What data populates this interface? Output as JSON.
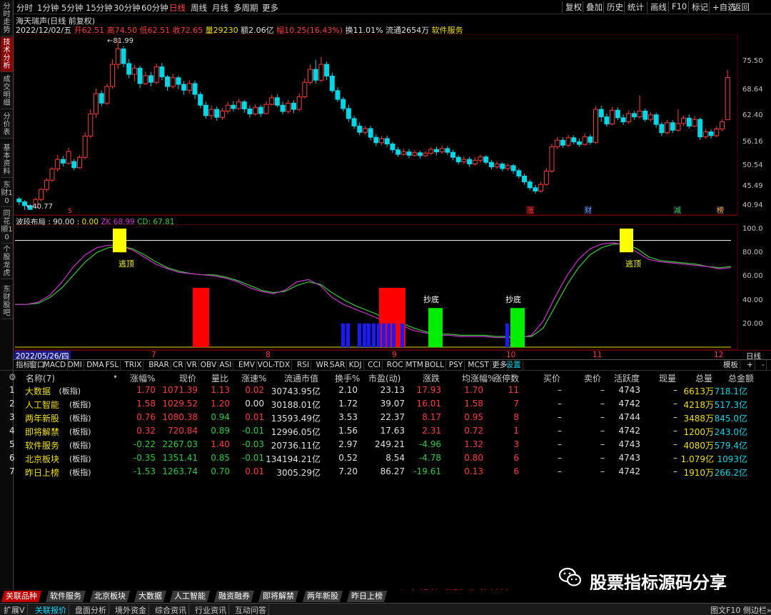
{
  "sidebar": [
    {
      "label": "分时走势",
      "active": false
    },
    {
      "label": "技术分析",
      "active": true
    },
    {
      "label": "成交明细",
      "active": false
    },
    {
      "label": "分价表",
      "active": false
    },
    {
      "label": "基本资料",
      "active": false
    },
    {
      "label": "东财10",
      "active": false
    },
    {
      "label": "同花顺10",
      "active": false
    },
    {
      "label": "个股龙虎",
      "active": false
    },
    {
      "label": "东财股吧",
      "active": false
    }
  ],
  "periods": [
    "分时",
    "1分钟",
    "5分钟",
    "15分钟",
    "30分钟",
    "60分钟",
    "日线",
    "周线",
    "月线",
    "多周期",
    "更多"
  ],
  "period_selected": "日线",
  "toolbar": [
    "复权",
    "叠加",
    "历史",
    "统计",
    "画线",
    "F10",
    "标记",
    "+自选",
    "返回"
  ],
  "stock": {
    "title": "海天瑞声(日线 前复权)",
    "date": "2022/12/02/五",
    "open_label": "开",
    "open": "62.51",
    "high_label": "高",
    "high": "74.50",
    "low_label": "低",
    "low": "62.51",
    "close_label": "收",
    "close": "72.65",
    "vol_label": "量",
    "vol": "29230",
    "amount_label": "额",
    "amount": "2.06亿",
    "change_label": "幅",
    "change": "10.25(16.43%)",
    "turnover": "换11.01%",
    "float": "流通2654万",
    "industry": "软件服务"
  },
  "price_axis": [
    "75.50",
    "68.64",
    "62.40",
    "56.16",
    "50.54",
    "45.49",
    "40.94"
  ],
  "price_marks": {
    "high": "81.99",
    "low": "40.77"
  },
  "event_marks": [
    {
      "text": "涨",
      "color": "#ff3c3c"
    },
    {
      "text": "财",
      "color": "#6aa0ff"
    },
    {
      "text": "减",
      "color": "#2ecc40"
    },
    {
      "text": "榜",
      "color": "#ffb030"
    }
  ],
  "indicator": {
    "name": "波段布局",
    "param1": "90.00",
    "param2": "0.00",
    "zk_label": "ZK",
    "zk": "68.99",
    "cd_label": "CD",
    "cd": "67.81",
    "axis": [
      "100.0",
      "80.00",
      "60.00",
      "40.00",
      "20.00"
    ],
    "signal_top": "逃顶",
    "signal_bottom": "抄底"
  },
  "date_axis": {
    "start": "2022/05/26/四",
    "months": [
      "7",
      "8",
      "9",
      "10",
      "11",
      "12"
    ],
    "right_label": "日线"
  },
  "indicator_tabs": [
    "指标",
    "窗口",
    "MACD",
    "DMI",
    "DMA",
    "FSL",
    "TRIX",
    "BRAR",
    "CR",
    "VR",
    "OBV",
    "ASI",
    "EMV",
    "VOL-TDX",
    "RSI",
    "WR",
    "SAR",
    "KDJ",
    "CCI",
    "ROC",
    "MTM",
    "BOLL",
    "PSY",
    "MCST",
    "更多",
    "设置"
  ],
  "indicator_tab_right": [
    "模板",
    "+",
    "-"
  ],
  "table": {
    "columns": [
      "名称(7)",
      "涨幅%",
      "现价",
      "量比",
      "涨速%",
      "流通市值",
      "换手%",
      "市盈(动)",
      "涨跌",
      "均涨幅%",
      "涨停数",
      "买价",
      "卖价",
      "活跃度",
      "现量",
      "总量",
      "总金额"
    ],
    "rows": [
      {
        "no": "1",
        "name": "大数据",
        "tag": "(板指)",
        "chg": "1.70",
        "price": "1071.39",
        "lb": "1.13",
        "speed": "0.02",
        "cap": "30743.95亿",
        "turn": "2.10",
        "pe": "23.13",
        "diff": "17.93",
        "avg": "1.70",
        "zt": "11",
        "bid": "–",
        "ask": "–",
        "act": "4743",
        "cur": "–",
        "vol": "6613万",
        "amt": "718.1亿"
      },
      {
        "no": "2",
        "name": "人工智能",
        "tag": "(板指)",
        "chg": "1.58",
        "price": "1029.52",
        "lb": "1.20",
        "speed": "0.00",
        "cap": "30188.01亿",
        "turn": "1.72",
        "pe": "39.07",
        "diff": "16.01",
        "avg": "1.58",
        "zt": "7",
        "bid": "–",
        "ask": "–",
        "act": "4742",
        "cur": "–",
        "vol": "4218万",
        "amt": "517.3亿"
      },
      {
        "no": "3",
        "name": "两年新股",
        "tag": "(板指)",
        "chg": "0.76",
        "price": "1080.38",
        "lb": "0.94",
        "speed": "0.01",
        "cap": "13593.49亿",
        "turn": "3.53",
        "pe": "22.37",
        "diff": "8.17",
        "avg": "0.95",
        "zt": "8",
        "bid": "–",
        "ask": "–",
        "act": "4744",
        "cur": "–",
        "vol": "3488万",
        "amt": "845.0亿"
      },
      {
        "no": "4",
        "name": "即将解禁",
        "tag": "(板指)",
        "chg": "0.32",
        "price": "720.84",
        "lb": "0.89",
        "speed": "-0.01",
        "cap": "12996.05亿",
        "turn": "1.56",
        "pe": "17.63",
        "diff": "2.31",
        "avg": "0.72",
        "zt": "1",
        "bid": "–",
        "ask": "–",
        "act": "4742",
        "cur": "–",
        "vol": "1200万",
        "amt": "243.0亿"
      },
      {
        "no": "5",
        "name": "软件服务",
        "tag": "(板指)",
        "chg": "-0.22",
        "price": "2267.03",
        "lb": "1.40",
        "speed": "-0.03",
        "cap": "20736.11亿",
        "turn": "2.97",
        "pe": "249.21",
        "diff": "-4.96",
        "avg": "1.32",
        "zt": "3",
        "bid": "–",
        "ask": "–",
        "act": "4743",
        "cur": "–",
        "vol": "4080万",
        "amt": "579.4亿"
      },
      {
        "no": "6",
        "name": "北京板块",
        "tag": "(板指)",
        "chg": "-0.35",
        "price": "1351.41",
        "lb": "0.85",
        "speed": "-0.01",
        "cap": "134194.21亿",
        "turn": "0.52",
        "pe": "8.54",
        "diff": "-4.78",
        "avg": "0.80",
        "zt": "6",
        "bid": "–",
        "ask": "–",
        "act": "4743",
        "cur": "–",
        "vol": "1.079亿",
        "amt": "1093亿"
      },
      {
        "no": "7",
        "name": "昨日上榜",
        "tag": "(板指)",
        "chg": "-1.53",
        "price": "1263.74",
        "lb": "0.70",
        "speed": "0.01",
        "cap": "3005.29亿",
        "turn": "7.20",
        "pe": "86.27",
        "diff": "-19.61",
        "avg": "0.13",
        "zt": "6",
        "bid": "–",
        "ask": "–",
        "act": "4742",
        "cur": "–",
        "vol": "1910万",
        "amt": "266.2亿"
      }
    ]
  },
  "watermark": {
    "brand": "股票指标源码分享",
    "slogan": "心中想着 伴随 你的姑娘"
  },
  "block_tabs": [
    "关联品种",
    "软件服务",
    "北京板块",
    "大数据",
    "人工智能",
    "融资融券",
    "即将解禁",
    "两年新股",
    "昨日上榜"
  ],
  "status_bar": [
    "扩展V",
    "关联报价",
    "盘面分析",
    "境外资金",
    "综合资讯",
    "行业资讯",
    "互动问答"
  ],
  "status_right": "图文F10 侧边栏»",
  "colors": {
    "up": "#ff3c3c",
    "down": "#00d7e6",
    "zk": "#cc33cc",
    "cd": "#33cc33",
    "signal_top": "#ffff00",
    "signal_bottom": "#00ee00",
    "red_bar": "#ff0000",
    "blue_bar": "#1a1aff"
  },
  "kline_series": [
    {
      "o": 43.5,
      "c": 42.8,
      "h": 44.0,
      "l": 42.0
    },
    {
      "o": 42.8,
      "c": 41.9,
      "h": 43.2,
      "l": 40.9
    },
    {
      "o": 41.9,
      "c": 41.0,
      "h": 42.3,
      "l": 40.8
    },
    {
      "o": 41.5,
      "c": 43.4,
      "h": 43.8,
      "l": 41.2
    },
    {
      "o": 43.4,
      "c": 45.8,
      "h": 46.1,
      "l": 43.0
    },
    {
      "o": 45.8,
      "c": 48.0,
      "h": 48.5,
      "l": 45.3
    },
    {
      "o": 48.0,
      "c": 50.7,
      "h": 51.2,
      "l": 47.6
    },
    {
      "o": 50.7,
      "c": 53.0,
      "h": 54.1,
      "l": 50.1
    },
    {
      "o": 53.0,
      "c": 52.1,
      "h": 53.8,
      "l": 51.3
    },
    {
      "o": 52.1,
      "c": 54.9,
      "h": 55.8,
      "l": 51.7
    },
    {
      "o": 52.5,
      "c": 51.0,
      "h": 53.1,
      "l": 50.4
    },
    {
      "o": 51.0,
      "c": 53.5,
      "h": 54.0,
      "l": 50.8
    },
    {
      "o": 53.5,
      "c": 58.6,
      "h": 59.5,
      "l": 53.0
    },
    {
      "o": 58.6,
      "c": 63.9,
      "h": 65.0,
      "l": 58.1
    },
    {
      "o": 63.9,
      "c": 68.8,
      "h": 70.0,
      "l": 63.0
    },
    {
      "o": 68.8,
      "c": 66.5,
      "h": 69.5,
      "l": 65.8
    },
    {
      "o": 66.5,
      "c": 70.5,
      "h": 71.2,
      "l": 66.0
    },
    {
      "o": 70.5,
      "c": 75.8,
      "h": 77.0,
      "l": 70.0
    },
    {
      "o": 75.8,
      "c": 79.5,
      "h": 81.99,
      "l": 74.7
    },
    {
      "o": 79.5,
      "c": 76.0,
      "h": 80.2,
      "l": 75.1
    },
    {
      "o": 76.0,
      "c": 73.4,
      "h": 77.1,
      "l": 72.5
    },
    {
      "o": 73.4,
      "c": 74.9,
      "h": 75.7,
      "l": 71.8
    },
    {
      "o": 74.9,
      "c": 71.2,
      "h": 75.5,
      "l": 70.1
    },
    {
      "o": 71.2,
      "c": 73.1,
      "h": 74.1,
      "l": 70.8
    },
    {
      "o": 73.1,
      "c": 71.5,
      "h": 74.0,
      "l": 70.5
    },
    {
      "o": 71.5,
      "c": 75.2,
      "h": 76.0,
      "l": 71.0
    },
    {
      "o": 75.2,
      "c": 72.8,
      "h": 76.1,
      "l": 72.0
    },
    {
      "o": 72.8,
      "c": 70.5,
      "h": 73.2,
      "l": 69.5
    },
    {
      "o": 70.5,
      "c": 72.6,
      "h": 73.5,
      "l": 70.0
    },
    {
      "o": 72.6,
      "c": 71.0,
      "h": 73.1,
      "l": 69.8
    },
    {
      "o": 71.0,
      "c": 69.6,
      "h": 71.8,
      "l": 68.5
    },
    {
      "o": 69.6,
      "c": 71.2,
      "h": 72.0,
      "l": 68.8
    },
    {
      "o": 71.2,
      "c": 68.6,
      "h": 71.9,
      "l": 67.5
    },
    {
      "o": 68.6,
      "c": 66.0,
      "h": 69.2,
      "l": 65.3
    },
    {
      "o": 66.0,
      "c": 63.5,
      "h": 66.8,
      "l": 62.8
    },
    {
      "o": 63.5,
      "c": 65.0,
      "h": 65.9,
      "l": 62.6
    },
    {
      "o": 65.0,
      "c": 63.1,
      "h": 65.7,
      "l": 62.3
    },
    {
      "o": 63.1,
      "c": 64.6,
      "h": 65.3,
      "l": 62.5
    },
    {
      "o": 64.6,
      "c": 66.0,
      "h": 66.8,
      "l": 64.0
    },
    {
      "o": 66.0,
      "c": 65.2,
      "h": 67.0,
      "l": 64.5
    },
    {
      "o": 65.2,
      "c": 66.8,
      "h": 67.5,
      "l": 64.9
    },
    {
      "o": 66.8,
      "c": 65.1,
      "h": 67.3,
      "l": 64.2
    },
    {
      "o": 65.1,
      "c": 63.9,
      "h": 66.0,
      "l": 63.0
    },
    {
      "o": 63.9,
      "c": 65.5,
      "h": 66.2,
      "l": 63.5
    },
    {
      "o": 65.5,
      "c": 64.0,
      "h": 66.1,
      "l": 63.2
    },
    {
      "o": 64.0,
      "c": 66.2,
      "h": 66.9,
      "l": 63.8
    },
    {
      "o": 66.2,
      "c": 67.8,
      "h": 68.5,
      "l": 65.9
    },
    {
      "o": 67.8,
      "c": 66.0,
      "h": 68.6,
      "l": 65.5
    },
    {
      "o": 66.0,
      "c": 64.5,
      "h": 66.9,
      "l": 63.8
    },
    {
      "o": 64.5,
      "c": 66.5,
      "h": 67.3,
      "l": 64.0
    },
    {
      "o": 66.5,
      "c": 65.0,
      "h": 67.2,
      "l": 64.1
    },
    {
      "o": 65.0,
      "c": 68.0,
      "h": 68.8,
      "l": 64.6
    },
    {
      "o": 68.0,
      "c": 71.5,
      "h": 72.4,
      "l": 67.7
    },
    {
      "o": 71.5,
      "c": 74.6,
      "h": 75.8,
      "l": 71.0
    },
    {
      "o": 74.6,
      "c": 72.0,
      "h": 76.9,
      "l": 71.2
    },
    {
      "o": 72.0,
      "c": 75.8,
      "h": 77.6,
      "l": 71.5
    },
    {
      "o": 75.8,
      "c": 73.0,
      "h": 76.5,
      "l": 72.0
    },
    {
      "o": 73.0,
      "c": 69.5,
      "h": 73.8,
      "l": 69.0
    },
    {
      "o": 69.5,
      "c": 67.4,
      "h": 70.3,
      "l": 66.8
    },
    {
      "o": 67.4,
      "c": 65.2,
      "h": 68.0,
      "l": 64.5
    },
    {
      "o": 65.2,
      "c": 62.8,
      "h": 66.1,
      "l": 62.0
    },
    {
      "o": 62.8,
      "c": 61.0,
      "h": 63.5,
      "l": 60.3
    },
    {
      "o": 61.0,
      "c": 59.5,
      "h": 61.9,
      "l": 58.8
    },
    {
      "o": 59.5,
      "c": 60.4,
      "h": 61.0,
      "l": 58.9
    },
    {
      "o": 60.4,
      "c": 58.3,
      "h": 61.1,
      "l": 57.6
    },
    {
      "o": 58.3,
      "c": 57.0,
      "h": 59.0,
      "l": 56.2
    },
    {
      "o": 57.0,
      "c": 58.0,
      "h": 58.6,
      "l": 56.4
    },
    {
      "o": 58.0,
      "c": 56.7,
      "h": 58.7,
      "l": 56.0
    },
    {
      "o": 56.7,
      "c": 55.3,
      "h": 57.2,
      "l": 54.6
    },
    {
      "o": 55.3,
      "c": 54.2,
      "h": 56.0,
      "l": 53.6
    },
    {
      "o": 54.2,
      "c": 54.8,
      "h": 55.6,
      "l": 53.9
    },
    {
      "o": 54.8,
      "c": 54.0,
      "h": 55.5,
      "l": 53.3
    },
    {
      "o": 54.0,
      "c": 54.6,
      "h": 55.2,
      "l": 53.7
    },
    {
      "o": 54.6,
      "c": 53.9,
      "h": 55.1,
      "l": 53.2
    },
    {
      "o": 53.9,
      "c": 54.5,
      "h": 55.0,
      "l": 53.6
    },
    {
      "o": 54.5,
      "c": 55.4,
      "h": 56.0,
      "l": 54.1
    },
    {
      "o": 55.4,
      "c": 54.8,
      "h": 56.1,
      "l": 54.0
    },
    {
      "o": 54.8,
      "c": 55.6,
      "h": 56.3,
      "l": 54.4
    },
    {
      "o": 55.6,
      "c": 54.7,
      "h": 56.2,
      "l": 54.1
    },
    {
      "o": 54.7,
      "c": 53.5,
      "h": 55.3,
      "l": 52.8
    },
    {
      "o": 53.5,
      "c": 52.4,
      "h": 54.0,
      "l": 51.8
    },
    {
      "o": 52.4,
      "c": 53.0,
      "h": 53.7,
      "l": 51.9
    },
    {
      "o": 53.0,
      "c": 51.9,
      "h": 53.6,
      "l": 51.2
    },
    {
      "o": 51.9,
      "c": 52.8,
      "h": 53.5,
      "l": 51.5
    },
    {
      "o": 52.8,
      "c": 53.6,
      "h": 54.2,
      "l": 52.2
    },
    {
      "o": 53.6,
      "c": 52.3,
      "h": 54.0,
      "l": 51.8
    },
    {
      "o": 52.3,
      "c": 51.2,
      "h": 52.9,
      "l": 50.6
    },
    {
      "o": 51.2,
      "c": 51.9,
      "h": 52.5,
      "l": 50.8
    },
    {
      "o": 51.9,
      "c": 50.8,
      "h": 52.3,
      "l": 50.2
    },
    {
      "o": 50.8,
      "c": 51.5,
      "h": 52.0,
      "l": 50.3
    },
    {
      "o": 51.5,
      "c": 50.3,
      "h": 51.9,
      "l": 49.5
    },
    {
      "o": 50.3,
      "c": 49.0,
      "h": 50.8,
      "l": 48.4
    },
    {
      "o": 49.0,
      "c": 47.6,
      "h": 49.6,
      "l": 46.9
    },
    {
      "o": 47.6,
      "c": 46.2,
      "h": 48.2,
      "l": 45.6
    },
    {
      "o": 46.2,
      "c": 45.4,
      "h": 46.9,
      "l": 44.8
    },
    {
      "o": 45.4,
      "c": 47.0,
      "h": 47.6,
      "l": 45.0
    },
    {
      "o": 47.0,
      "c": 50.2,
      "h": 50.9,
      "l": 46.7
    },
    {
      "o": 50.2,
      "c": 56.0,
      "h": 56.7,
      "l": 49.8
    },
    {
      "o": 56.0,
      "c": 57.6,
      "h": 58.4,
      "l": 55.4
    },
    {
      "o": 57.6,
      "c": 56.4,
      "h": 58.3,
      "l": 55.8
    },
    {
      "o": 56.4,
      "c": 58.2,
      "h": 58.9,
      "l": 56.0
    },
    {
      "o": 58.2,
      "c": 57.2,
      "h": 58.8,
      "l": 56.6
    },
    {
      "o": 57.2,
      "c": 56.6,
      "h": 58.0,
      "l": 56.0
    },
    {
      "o": 56.6,
      "c": 58.4,
      "h": 59.2,
      "l": 56.3
    },
    {
      "o": 58.4,
      "c": 57.1,
      "h": 59.0,
      "l": 56.5
    },
    {
      "o": 57.1,
      "c": 65.0,
      "h": 65.8,
      "l": 56.8
    },
    {
      "o": 65.0,
      "c": 63.2,
      "h": 65.9,
      "l": 62.0
    },
    {
      "o": 63.2,
      "c": 61.5,
      "h": 64.0,
      "l": 60.8
    },
    {
      "o": 61.5,
      "c": 64.8,
      "h": 65.6,
      "l": 61.2
    },
    {
      "o": 64.8,
      "c": 63.0,
      "h": 65.5,
      "l": 62.4
    },
    {
      "o": 63.0,
      "c": 62.0,
      "h": 63.8,
      "l": 61.3
    },
    {
      "o": 62.0,
      "c": 64.0,
      "h": 64.7,
      "l": 61.6
    },
    {
      "o": 64.0,
      "c": 63.2,
      "h": 64.6,
      "l": 62.5
    },
    {
      "o": 63.2,
      "c": 64.6,
      "h": 68.4,
      "l": 62.8
    },
    {
      "o": 64.6,
      "c": 62.6,
      "h": 65.2,
      "l": 62.0
    },
    {
      "o": 62.6,
      "c": 63.7,
      "h": 64.3,
      "l": 62.1
    },
    {
      "o": 63.7,
      "c": 61.4,
      "h": 64.2,
      "l": 60.6
    },
    {
      "o": 61.4,
      "c": 59.4,
      "h": 62.0,
      "l": 58.6
    },
    {
      "o": 59.4,
      "c": 61.8,
      "h": 62.5,
      "l": 59.0
    },
    {
      "o": 61.8,
      "c": 60.0,
      "h": 62.4,
      "l": 59.3
    },
    {
      "o": 60.0,
      "c": 61.6,
      "h": 65.0,
      "l": 59.6
    },
    {
      "o": 61.6,
      "c": 62.9,
      "h": 63.5,
      "l": 61.0
    },
    {
      "o": 62.9,
      "c": 61.0,
      "h": 63.8,
      "l": 60.4
    },
    {
      "o": 61.0,
      "c": 62.6,
      "h": 63.4,
      "l": 60.7
    },
    {
      "o": 62.6,
      "c": 58.4,
      "h": 63.0,
      "l": 57.7
    },
    {
      "o": 58.4,
      "c": 59.6,
      "h": 60.3,
      "l": 57.9
    },
    {
      "o": 59.6,
      "c": 58.7,
      "h": 60.2,
      "l": 58.0
    },
    {
      "o": 58.7,
      "c": 60.3,
      "h": 61.0,
      "l": 58.3
    },
    {
      "o": 60.3,
      "c": 62.0,
      "h": 62.6,
      "l": 59.8
    },
    {
      "o": 62.51,
      "c": 72.65,
      "h": 74.5,
      "l": 62.51
    }
  ]
}
